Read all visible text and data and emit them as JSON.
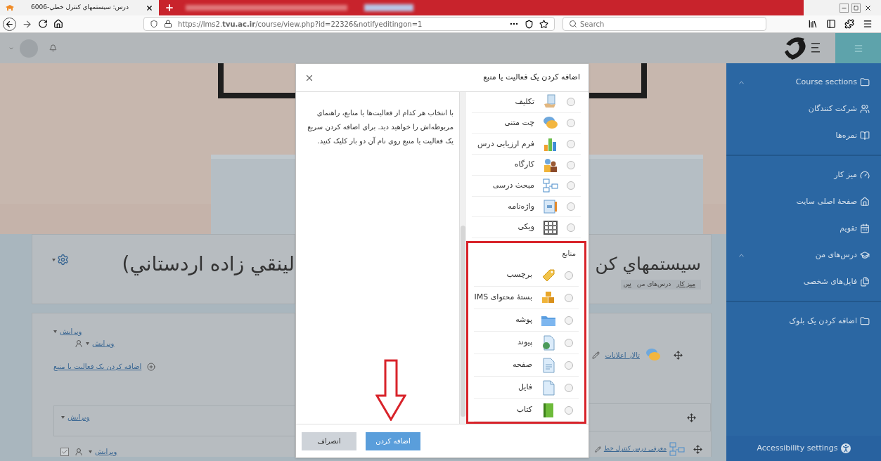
{
  "browser": {
    "tab": {
      "title": "درس: سيستمهاي كنترل خطي-6006"
    },
    "url": "https://lms2.**tvu.ac.ir**/course/view.php?id=22326&notifyeditingon=1",
    "search": {
      "placeholder": "Search"
    }
  },
  "course": {
    "title_left": "لينقي زاده اردستاني)",
    "title_right": "سيستمهاي كن",
    "breadcrumb": [
      {
        "label": "ميز كار",
        "kind": "link"
      },
      {
        "label": "درس‌های من",
        "kind": "text"
      },
      {
        "label": "س",
        "kind": "link"
      }
    ]
  },
  "section_0": {
    "edit_menus": [
      "ویرایش",
      "ویرایش"
    ],
    "add_activity": "اضافه کردن یک فعالیت یا منبع",
    "forum": "تالار اعلانات"
  },
  "section_1": {
    "edit": "ویرایش"
  },
  "section_2": {
    "edit": "ویرایش",
    "checked": true,
    "activity": "معرفی درس کنترل خط"
  },
  "sidebar": {
    "groups": [
      {
        "items": [
          {
            "label": "Course sections",
            "kind": "heading"
          },
          {
            "label": "شرکت کنندگان",
            "kind": "link"
          },
          {
            "label": "نمره‌ها",
            "kind": "link"
          }
        ]
      },
      {
        "items": [
          {
            "label": "میز کار",
            "kind": "link"
          },
          {
            "label": "صفحهٔ اصلی سایت",
            "kind": "link"
          },
          {
            "label": "تقویم",
            "kind": "link"
          },
          {
            "label": "درس‌های من",
            "kind": "heading"
          },
          {
            "label": "فایل‌های شخصی",
            "kind": "link"
          }
        ]
      },
      {
        "items": [
          {
            "label": "اضافه کردن یک بلوک",
            "kind": "link"
          }
        ]
      }
    ],
    "accessibility": "Accessibility settings"
  },
  "modal": {
    "title": "اضافه کردن یک فعالیت یا منبع",
    "help_text": "با انتخاب هر کدام از فعالیت‌ها یا منابع، راهنمای مربوطه‌اش را خواهید دید. برای اضافه کردن سریع یک فعالیت یا منبع روی نام آن دو بار کلیک کنید.",
    "activities": [
      {
        "label": "تکلیف",
        "selected": false
      },
      {
        "label": "چت متنی",
        "selected": false
      },
      {
        "label": "فرم ارزیابی درس",
        "selected": false
      },
      {
        "label": "کارگاه",
        "selected": false
      },
      {
        "label": "مبحث درسی",
        "selected": false
      },
      {
        "label": "واژه‌نامه",
        "selected": false
      },
      {
        "label": "ویکی",
        "selected": false
      }
    ],
    "resources": {
      "heading": "منابع",
      "items": [
        {
          "label": "برچسب",
          "selected": false
        },
        {
          "label": "بستهٔ محتوای IMS",
          "selected": false
        },
        {
          "label": "پوشه",
          "selected": false
        },
        {
          "label": "پیوند",
          "selected": false
        },
        {
          "label": "صفحه",
          "selected": false
        },
        {
          "label": "فایل",
          "selected": false
        },
        {
          "label": "کتاب",
          "selected": false
        }
      ]
    },
    "buttons": [
      {
        "label": "اضافه کردن",
        "kind": "primary"
      },
      {
        "label": "انصراف",
        "kind": "secondary"
      }
    ]
  }
}
